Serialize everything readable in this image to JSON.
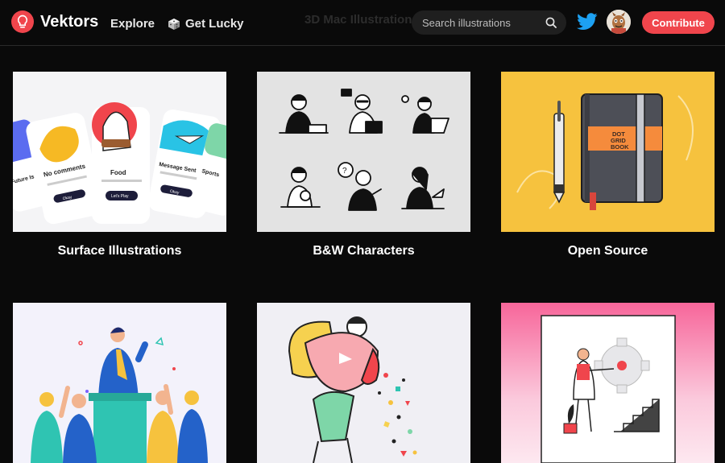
{
  "header": {
    "brand": "Vektors",
    "nav": {
      "explore": "Explore",
      "get_lucky": "Get Lucky"
    },
    "background_title": "3D Mac Illustration",
    "search": {
      "placeholder": "Search illustrations"
    },
    "contribute_label": "Contribute"
  },
  "colors": {
    "accent": "#f0454c",
    "background": "#0a0a0a",
    "twitter": "#1da1f2"
  },
  "icons": {
    "logo": "lightbulb-icon",
    "dice": "dice-icon",
    "search": "search-icon",
    "twitter": "twitter-icon"
  },
  "cards": [
    {
      "title": "Surface Illustrations",
      "preview": {
        "card_labels": [
          "Future Is Now",
          "No comments",
          "Food",
          "Message Sent",
          "Sports"
        ],
        "button_labels": [
          "Okay",
          "Let's Play",
          "Okay"
        ]
      }
    },
    {
      "title": "B&W Characters"
    },
    {
      "title": "Open Source",
      "preview": {
        "notebook_label": [
          "DOT",
          "GRID",
          "BOOK"
        ]
      }
    },
    {
      "title": ""
    },
    {
      "title": ""
    },
    {
      "title": ""
    }
  ]
}
